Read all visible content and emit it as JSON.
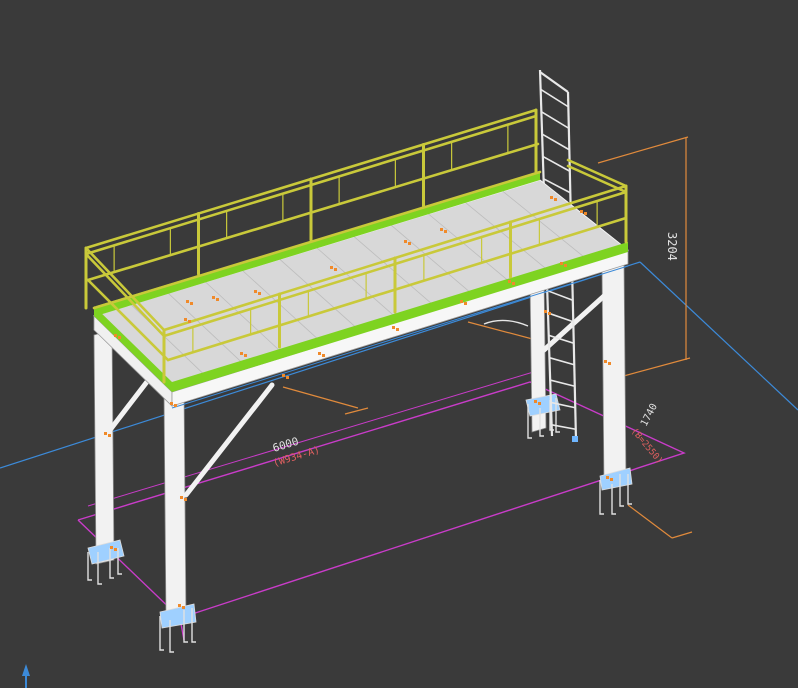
{
  "viewport": {
    "background": "#3a3a3a",
    "model": "steel-platform-with-ladder"
  },
  "colors": {
    "steel": "#f2f2f2",
    "steel_outline": "#9a9a9a",
    "handrail": "#c9c93a",
    "handrail_dark": "#8c8c22",
    "toe_board": "#7ed321",
    "deck": "#d8d8d8",
    "dimension_orange": "#e08a3c",
    "dimension_magenta": "#c93cc9",
    "axis_blue": "#3c8ad8",
    "bolt_orange": "#f08a2a",
    "base_plate": "#9fd0ff"
  },
  "dimensions": {
    "height": "3204",
    "length": "6000",
    "length_note": "(W934-A)",
    "width": "1740",
    "width_note": "(B=2550)"
  },
  "icons": {
    "axis_indicator": "ucs-axis-icon"
  }
}
